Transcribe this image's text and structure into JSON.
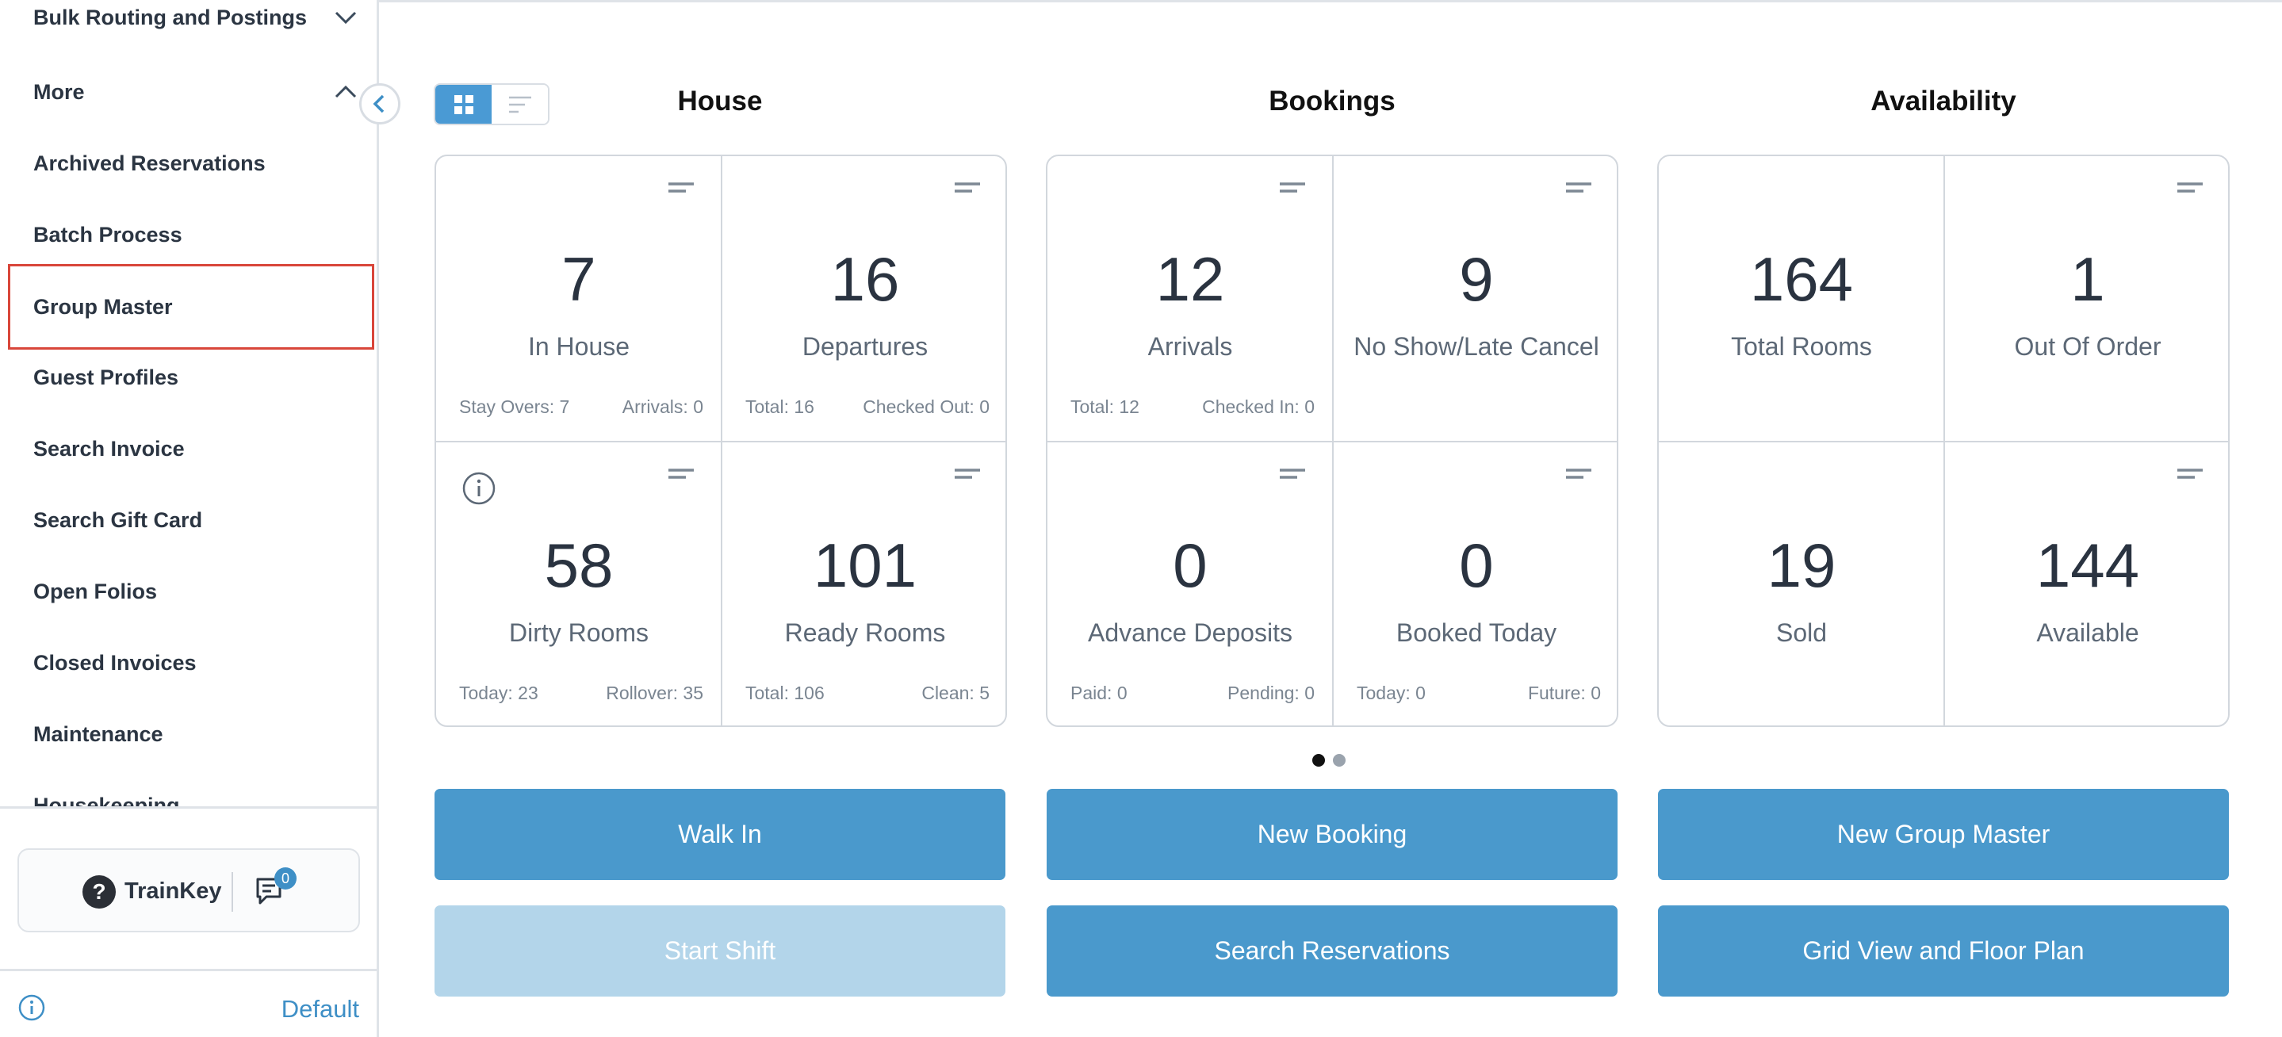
{
  "sidebar": {
    "items": [
      {
        "label": "Bulk Routing and Postings",
        "chevron": "chevron-down"
      },
      {
        "label": "More",
        "chevron": "chevron-up"
      },
      {
        "label": "Archived Reservations"
      },
      {
        "label": "Batch Process"
      },
      {
        "label": "Group Master",
        "highlighted": true
      },
      {
        "label": "Guest Profiles"
      },
      {
        "label": "Search Invoice"
      },
      {
        "label": "Search Gift Card"
      },
      {
        "label": "Open Folios"
      },
      {
        "label": "Closed Invoices"
      },
      {
        "label": "Maintenance"
      },
      {
        "label": "Housekeeping"
      }
    ],
    "trainkey": {
      "label": "TrainKey",
      "help_icon": "?",
      "chat_badge": "0"
    },
    "footer": {
      "default_label": "Default"
    }
  },
  "sections": {
    "house": {
      "title": "House"
    },
    "bookings": {
      "title": "Bookings"
    },
    "availability": {
      "title": "Availability"
    }
  },
  "tiles": {
    "in_house": {
      "value": "7",
      "label": "In House",
      "sub_left": "Stay Overs: 7",
      "sub_right": "Arrivals: 0"
    },
    "departures": {
      "value": "16",
      "label": "Departures",
      "sub_left": "Total: 16",
      "sub_right": "Checked Out: 0"
    },
    "dirty_rooms": {
      "value": "58",
      "label": "Dirty Rooms",
      "sub_left": "Today: 23",
      "sub_right": "Rollover: 35"
    },
    "ready_rooms": {
      "value": "101",
      "label": "Ready Rooms",
      "sub_left": "Total: 106",
      "sub_right": "Clean: 5"
    },
    "arrivals": {
      "value": "12",
      "label": "Arrivals",
      "sub_left": "Total: 12",
      "sub_right": "Checked In: 0"
    },
    "no_show": {
      "value": "9",
      "label": "No Show/Late Cancel"
    },
    "advance_deposits": {
      "value": "0",
      "label": "Advance Deposits",
      "sub_left": "Paid: 0",
      "sub_right": "Pending: 0"
    },
    "booked_today": {
      "value": "0",
      "label": "Booked Today",
      "sub_left": "Today: 0",
      "sub_right": "Future: 0"
    },
    "total_rooms": {
      "value": "164",
      "label": "Total Rooms"
    },
    "out_of_order": {
      "value": "1",
      "label": "Out Of Order"
    },
    "sold": {
      "value": "19",
      "label": "Sold"
    },
    "available": {
      "value": "144",
      "label": "Available"
    }
  },
  "pagination": {
    "active_page": 1,
    "total_pages": 2
  },
  "actions": {
    "walk_in": "Walk In",
    "new_booking": "New Booking",
    "new_group_master": "New Group Master",
    "start_shift": "Start Shift",
    "search_reservations": "Search Reservations",
    "grid_view_floor_plan": "Grid View and Floor Plan"
  },
  "colors": {
    "accent": "#4a99cc",
    "disabled_button": "#b3d5ea",
    "highlight_border": "#d9463a",
    "link": "#3e8fc6"
  }
}
